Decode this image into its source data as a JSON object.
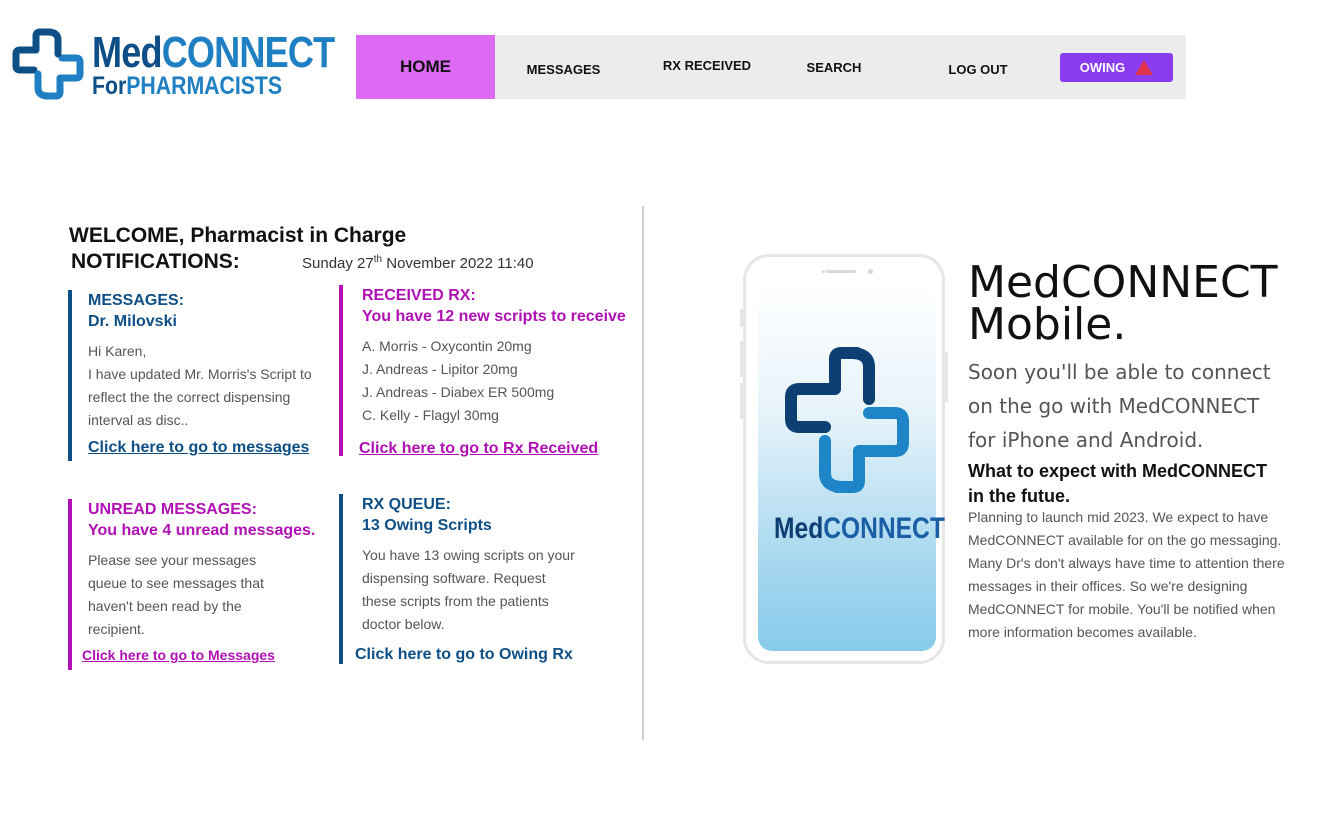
{
  "logo": {
    "line1_a": "Med",
    "line1_b": "CONNECT",
    "line2_a": "For",
    "line2_b": "PHARMACISTS"
  },
  "nav": {
    "home": "HOME",
    "messages": "MESSAGES",
    "rx_received": "RX RECEIVED",
    "search": "SEARCH",
    "logout": "LOG OUT",
    "owing": "OWING",
    "owing_icon": "warning-triangle-icon"
  },
  "welcome": {
    "greeting": "WELCOME, Pharmacist in Charge",
    "notifications": "NOTIFICATIONS:",
    "date_prefix": "Sunday 27",
    "date_sup": "th",
    "date_suffix": " November 2022 11:40"
  },
  "cards": {
    "messages": {
      "title": "MESSAGES:",
      "subtitle": "Dr. Milovski",
      "body": "Hi Karen,\nI have updated Mr. Morris's Script to reflect the the correct dispensing interval as disc..",
      "link": "Click here to go to messages"
    },
    "received": {
      "title": "RECEIVED RX:",
      "subtitle": "You have 12 new scripts to receive",
      "items": [
        "A. Morris - Oxycontin 20mg",
        "J. Andreas - Lipitor 20mg",
        "J. Andreas - Diabex ER 500mg",
        "C. Kelly - Flagyl 30mg"
      ],
      "link": "Click here to go to Rx Received"
    },
    "unread": {
      "title": "UNREAD MESSAGES:",
      "subtitle": "You have 4 unread messages.",
      "body": "Please see your messages queue to see messages that haven't been read by the recipient.",
      "link": "Click here to go to Messages"
    },
    "queue": {
      "title": "RX QUEUE:",
      "subtitle": "13 Owing Scripts",
      "body": "You have 13 owing scripts on your dispensing software. Request these scripts from the patients doctor below.",
      "link": "Click here to go to Owing Rx"
    }
  },
  "mobile": {
    "phone_brand_a": "Med",
    "phone_brand_b": "CONNECT",
    "title_line1": "MedCONNECT",
    "title_line2": "Mobile.",
    "subtitle": "Soon you'll be able to connect on the go with MedCONNECT for iPhone and Android.",
    "heading": "What to expect with MedCONNECT in the futue.",
    "body": "Planning to launch mid 2023. We expect to have MedCONNECT available for on the go messaging. Many Dr's don't always have time to attention there messages in their offices. So we're designing MedCONNECT for mobile. You'll be notified when more information becomes available."
  },
  "colors": {
    "brand_dark": "#0d4f86",
    "brand_light": "#1e7fc2",
    "home_active": "#dc6af2",
    "owing_button": "#8a3cf0",
    "accent_purple": "#b010b5",
    "nav_bg": "#ececec"
  }
}
